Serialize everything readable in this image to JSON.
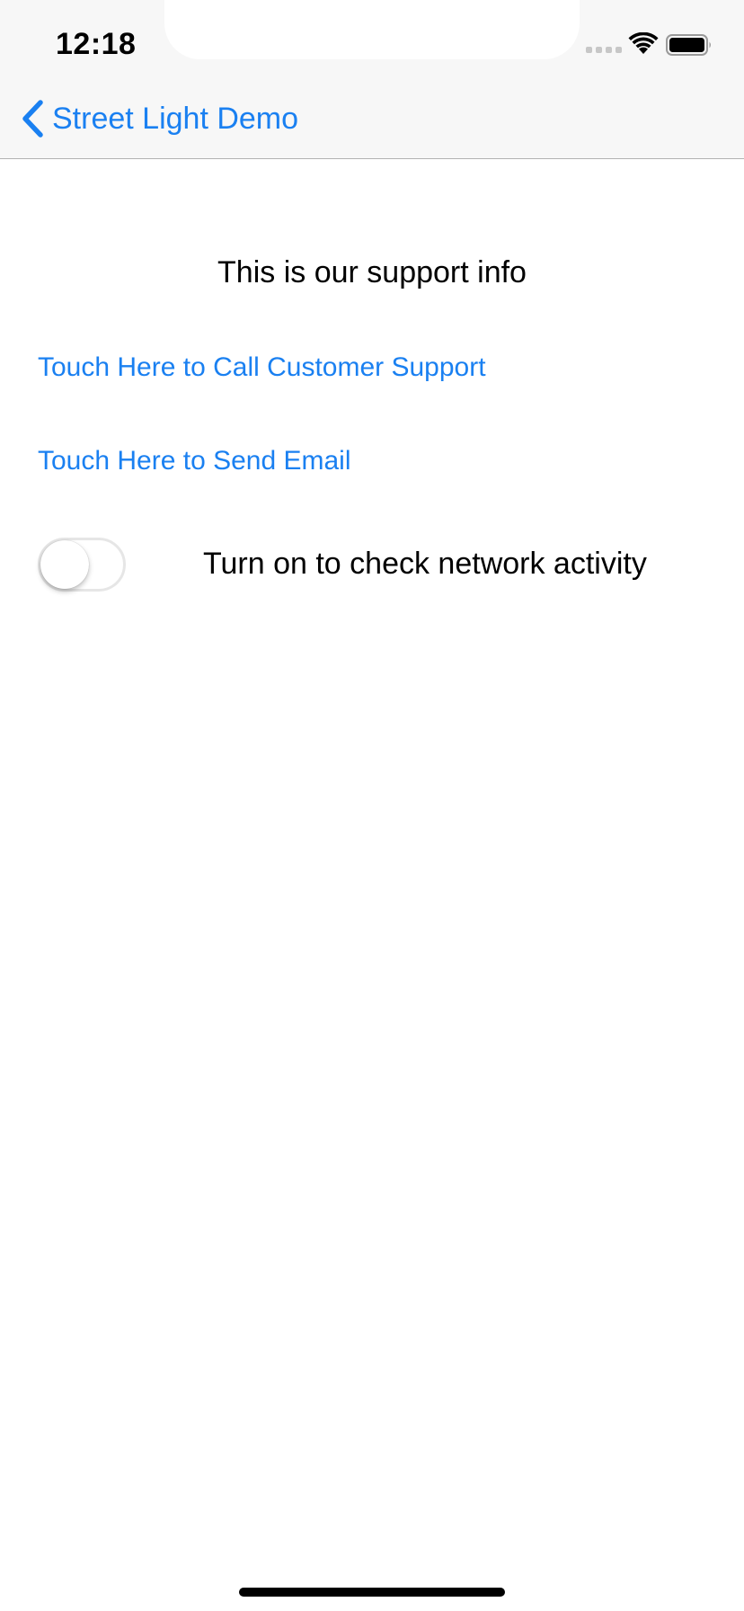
{
  "status_bar": {
    "time": "12:18"
  },
  "nav": {
    "back_label": "Street Light Demo"
  },
  "content": {
    "title": "This is our support info",
    "call_link": "Touch Here to Call Customer Support",
    "email_link": "Touch Here to Send Email",
    "toggle": {
      "state": "off",
      "label": "Turn on to check network activity"
    }
  },
  "icons": {
    "back": "chevron-left-icon",
    "wifi": "wifi-icon",
    "battery": "battery-icon",
    "signal": "cellular-signal-icon"
  },
  "colors": {
    "accent": "#1a80f1",
    "nav_background": "#f7f7f7",
    "text": "#000000"
  }
}
